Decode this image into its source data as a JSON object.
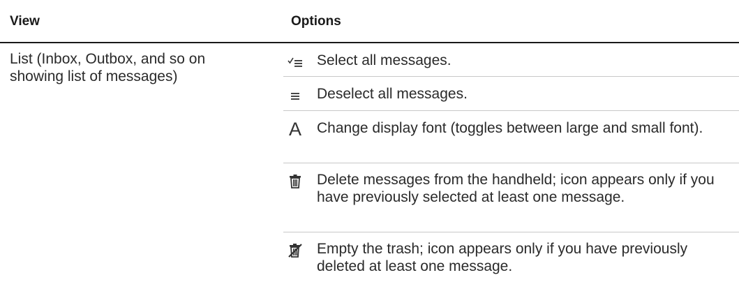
{
  "headers": {
    "view": "View",
    "options": "Options"
  },
  "view_cell": "List (Inbox, Outbox, and so on showing list of messages)",
  "options": [
    {
      "icon": "select-all-icon",
      "text": "Select all messages."
    },
    {
      "icon": "deselect-all-icon",
      "text": "Deselect all messages."
    },
    {
      "icon": "font-icon",
      "glyph": "A",
      "text": "Change display font (toggles between large and small font)."
    },
    {
      "icon": "trash-icon",
      "text": "Delete messages from the handheld; icon appears only if you have previously selected at least one message."
    },
    {
      "icon": "empty-trash-icon",
      "text": "Empty the trash; icon appears only if you have previously deleted at least one message."
    }
  ]
}
